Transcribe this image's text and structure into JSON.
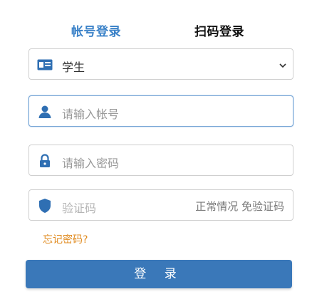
{
  "tabs": {
    "account_login": "帐号登录",
    "qr_login": "扫码登录"
  },
  "role_select": {
    "selected": "学生",
    "icon": "id-card-icon",
    "chevron": "chevron-down-icon"
  },
  "username": {
    "placeholder": "请输入帐号",
    "icon": "user-icon"
  },
  "password": {
    "placeholder": "请输入密码",
    "icon": "lock-icon"
  },
  "captcha": {
    "placeholder": "验证码",
    "status": "正常情况 免验证码",
    "icon": "shield-icon"
  },
  "forgot_password": "忘记密码?",
  "login_button": "登 录",
  "colors": {
    "accent": "#3a78b9",
    "tab_active": "#3b82c8",
    "forgot_link": "#e08a1e"
  }
}
